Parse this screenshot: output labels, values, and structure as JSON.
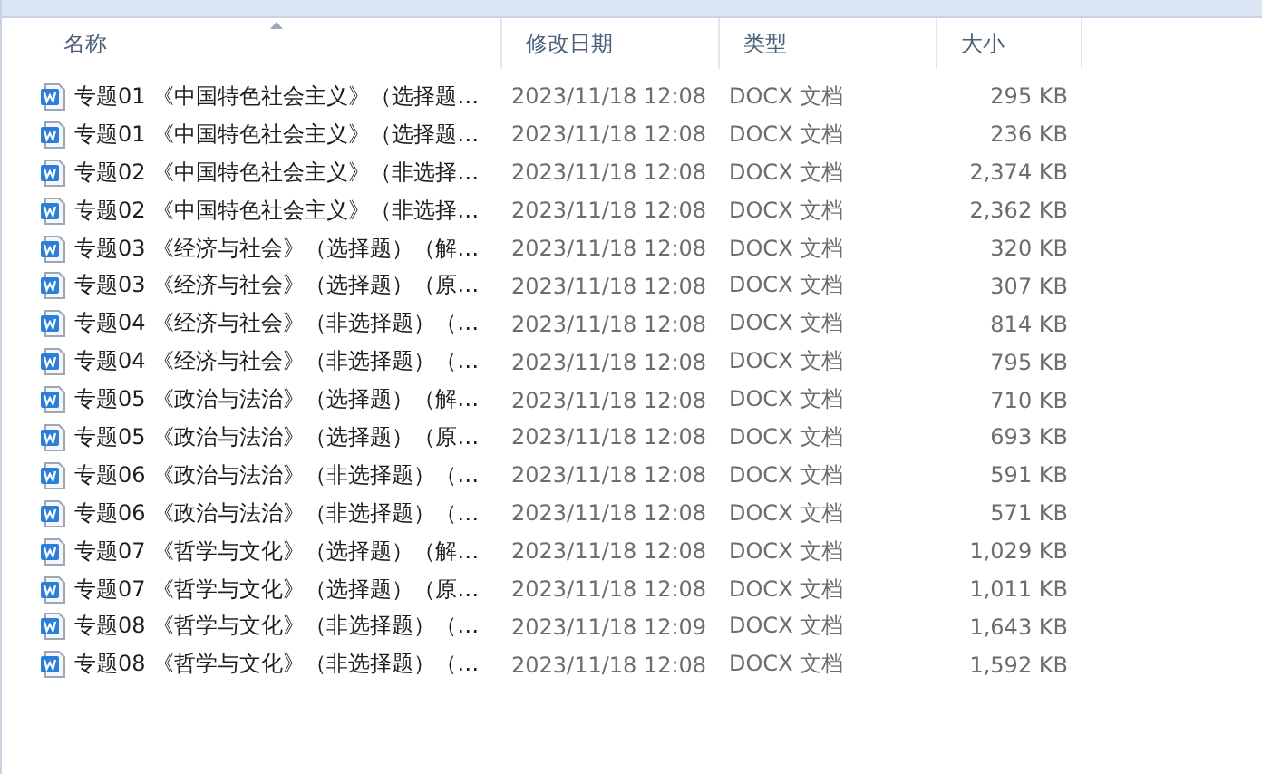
{
  "columns": [
    {
      "label": "名称",
      "sorted": true
    },
    {
      "label": "修改日期",
      "sorted": false
    },
    {
      "label": "类型",
      "sorted": false
    },
    {
      "label": "大小",
      "sorted": false
    }
  ],
  "rows": [
    {
      "name": "专题01 《中国特色社会主义》（选择题…",
      "date": "2023/11/18 12:08",
      "type": "DOCX 文档",
      "size": "295 KB"
    },
    {
      "name": "专题01 《中国特色社会主义》（选择题…",
      "date": "2023/11/18 12:08",
      "type": "DOCX 文档",
      "size": "236 KB"
    },
    {
      "name": "专题02 《中国特色社会主义》（非选择…",
      "date": "2023/11/18 12:08",
      "type": "DOCX 文档",
      "size": "2,374 KB"
    },
    {
      "name": "专题02 《中国特色社会主义》（非选择…",
      "date": "2023/11/18 12:08",
      "type": "DOCX 文档",
      "size": "2,362 KB"
    },
    {
      "name": "专题03 《经济与社会》（选择题）（解…",
      "date": "2023/11/18 12:08",
      "type": "DOCX 文档",
      "size": "320 KB"
    },
    {
      "name": "专题03 《经济与社会》（选择题）（原…",
      "date": "2023/11/18 12:08",
      "type": "DOCX 文档",
      "size": "307 KB"
    },
    {
      "name": "专题04 《经济与社会》（非选择题）（…",
      "date": "2023/11/18 12:08",
      "type": "DOCX 文档",
      "size": "814 KB"
    },
    {
      "name": "专题04 《经济与社会》（非选择题）（…",
      "date": "2023/11/18 12:08",
      "type": "DOCX 文档",
      "size": "795 KB"
    },
    {
      "name": "专题05 《政治与法治》（选择题）（解…",
      "date": "2023/11/18 12:08",
      "type": "DOCX 文档",
      "size": "710 KB"
    },
    {
      "name": "专题05 《政治与法治》（选择题）（原…",
      "date": "2023/11/18 12:08",
      "type": "DOCX 文档",
      "size": "693 KB"
    },
    {
      "name": "专题06 《政治与法治》（非选择题）（…",
      "date": "2023/11/18 12:08",
      "type": "DOCX 文档",
      "size": "591 KB"
    },
    {
      "name": "专题06 《政治与法治》（非选择题）（…",
      "date": "2023/11/18 12:08",
      "type": "DOCX 文档",
      "size": "571 KB"
    },
    {
      "name": "专题07 《哲学与文化》（选择题）（解…",
      "date": "2023/11/18 12:08",
      "type": "DOCX 文档",
      "size": "1,029 KB"
    },
    {
      "name": "专题07 《哲学与文化》（选择题）（原…",
      "date": "2023/11/18 12:08",
      "type": "DOCX 文档",
      "size": "1,011 KB"
    },
    {
      "name": "专题08 《哲学与文化》（非选择题）（…",
      "date": "2023/11/18 12:09",
      "type": "DOCX 文档",
      "size": "1,643 KB"
    },
    {
      "name": "专题08 《哲学与文化》（非选择题）（…",
      "date": "2023/11/18 12:08",
      "type": "DOCX 文档",
      "size": "1,592 KB"
    }
  ]
}
